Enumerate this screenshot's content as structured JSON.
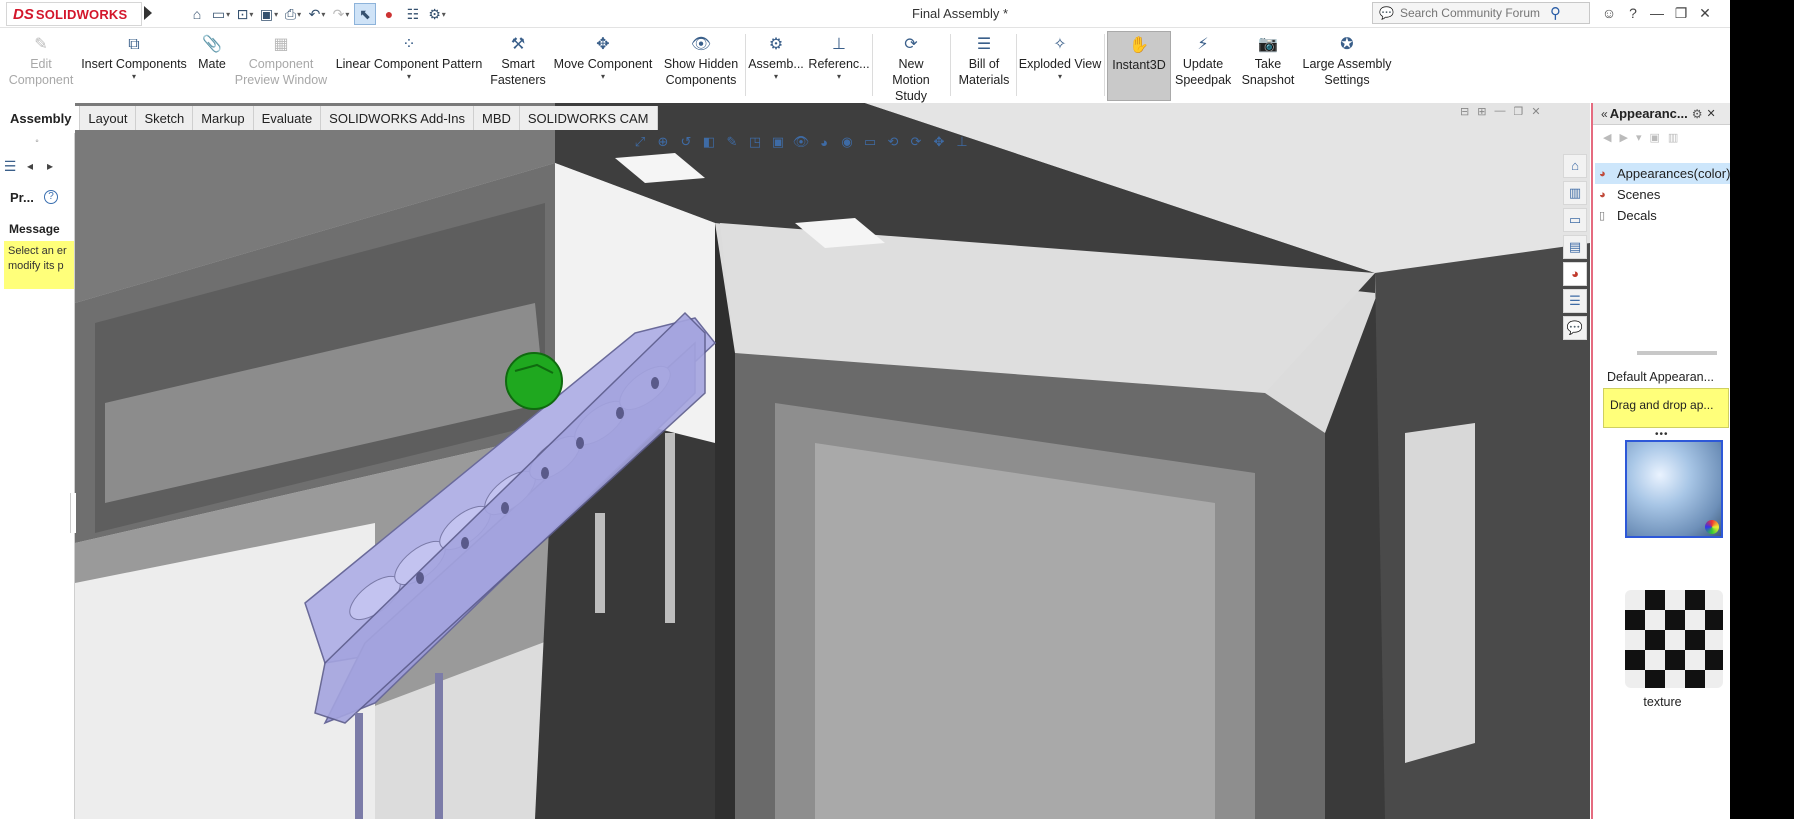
{
  "app": {
    "logo_ds": "DS",
    "logo_text": "SOLIDWORKS",
    "document_title": "Final Assembly *",
    "search_placeholder": "Search Community Forum"
  },
  "ribbon": [
    {
      "key": "edit-component",
      "label": "Edit Component",
      "disabled": true
    },
    {
      "key": "insert-components",
      "label": "Insert Components"
    },
    {
      "key": "mate",
      "label": "Mate"
    },
    {
      "key": "component-preview-window",
      "label": "Component Preview Window",
      "disabled": true
    },
    {
      "key": "linear-component-pattern",
      "label": "Linear Component Pattern"
    },
    {
      "key": "smart-fasteners",
      "label": "Smart Fasteners"
    },
    {
      "key": "move-component",
      "label": "Move Component"
    },
    {
      "key": "show-hidden-components",
      "label": "Show Hidden Components"
    },
    {
      "key": "assembly",
      "label": "Assemb..."
    },
    {
      "key": "reference",
      "label": "Referenc..."
    },
    {
      "key": "new-motion-study",
      "label": "New Motion Study"
    },
    {
      "key": "bill-of-materials",
      "label": "Bill of Materials"
    },
    {
      "key": "exploded-view",
      "label": "Exploded View"
    },
    {
      "key": "instant3d",
      "label": "Instant3D",
      "active": true
    },
    {
      "key": "update-speedpak",
      "label": "Update Speedpak"
    },
    {
      "key": "take-snapshot",
      "label": "Take Snapshot"
    },
    {
      "key": "large-assembly-settings",
      "label": "Large Assembly Settings"
    }
  ],
  "tabs": [
    "Assembly",
    "Layout",
    "Sketch",
    "Markup",
    "Evaluate",
    "SOLIDWORKS Add-Ins",
    "MBD",
    "SOLIDWORKS CAM"
  ],
  "property_manager": {
    "title": "Pr...",
    "help": "?",
    "message_title": "Message",
    "message_lines": [
      "Select an er",
      "modify its p"
    ]
  },
  "task_pane": {
    "title": "Appearanc...",
    "items": [
      {
        "label": "Appearances(color)",
        "selected": true
      },
      {
        "label": "Scenes"
      },
      {
        "label": "Decals"
      }
    ],
    "default_label": "Default Appearan...",
    "hint": "Drag and drop ap...",
    "texture_label": "texture"
  },
  "icons": {
    "home": "⌂",
    "new": "🗋",
    "open": "📂",
    "save": "💾",
    "print": "🖶",
    "undo": "↶",
    "redo": "↷",
    "select": "⬉",
    "traffic": "●",
    "options": "☷",
    "gear": "⚙"
  }
}
